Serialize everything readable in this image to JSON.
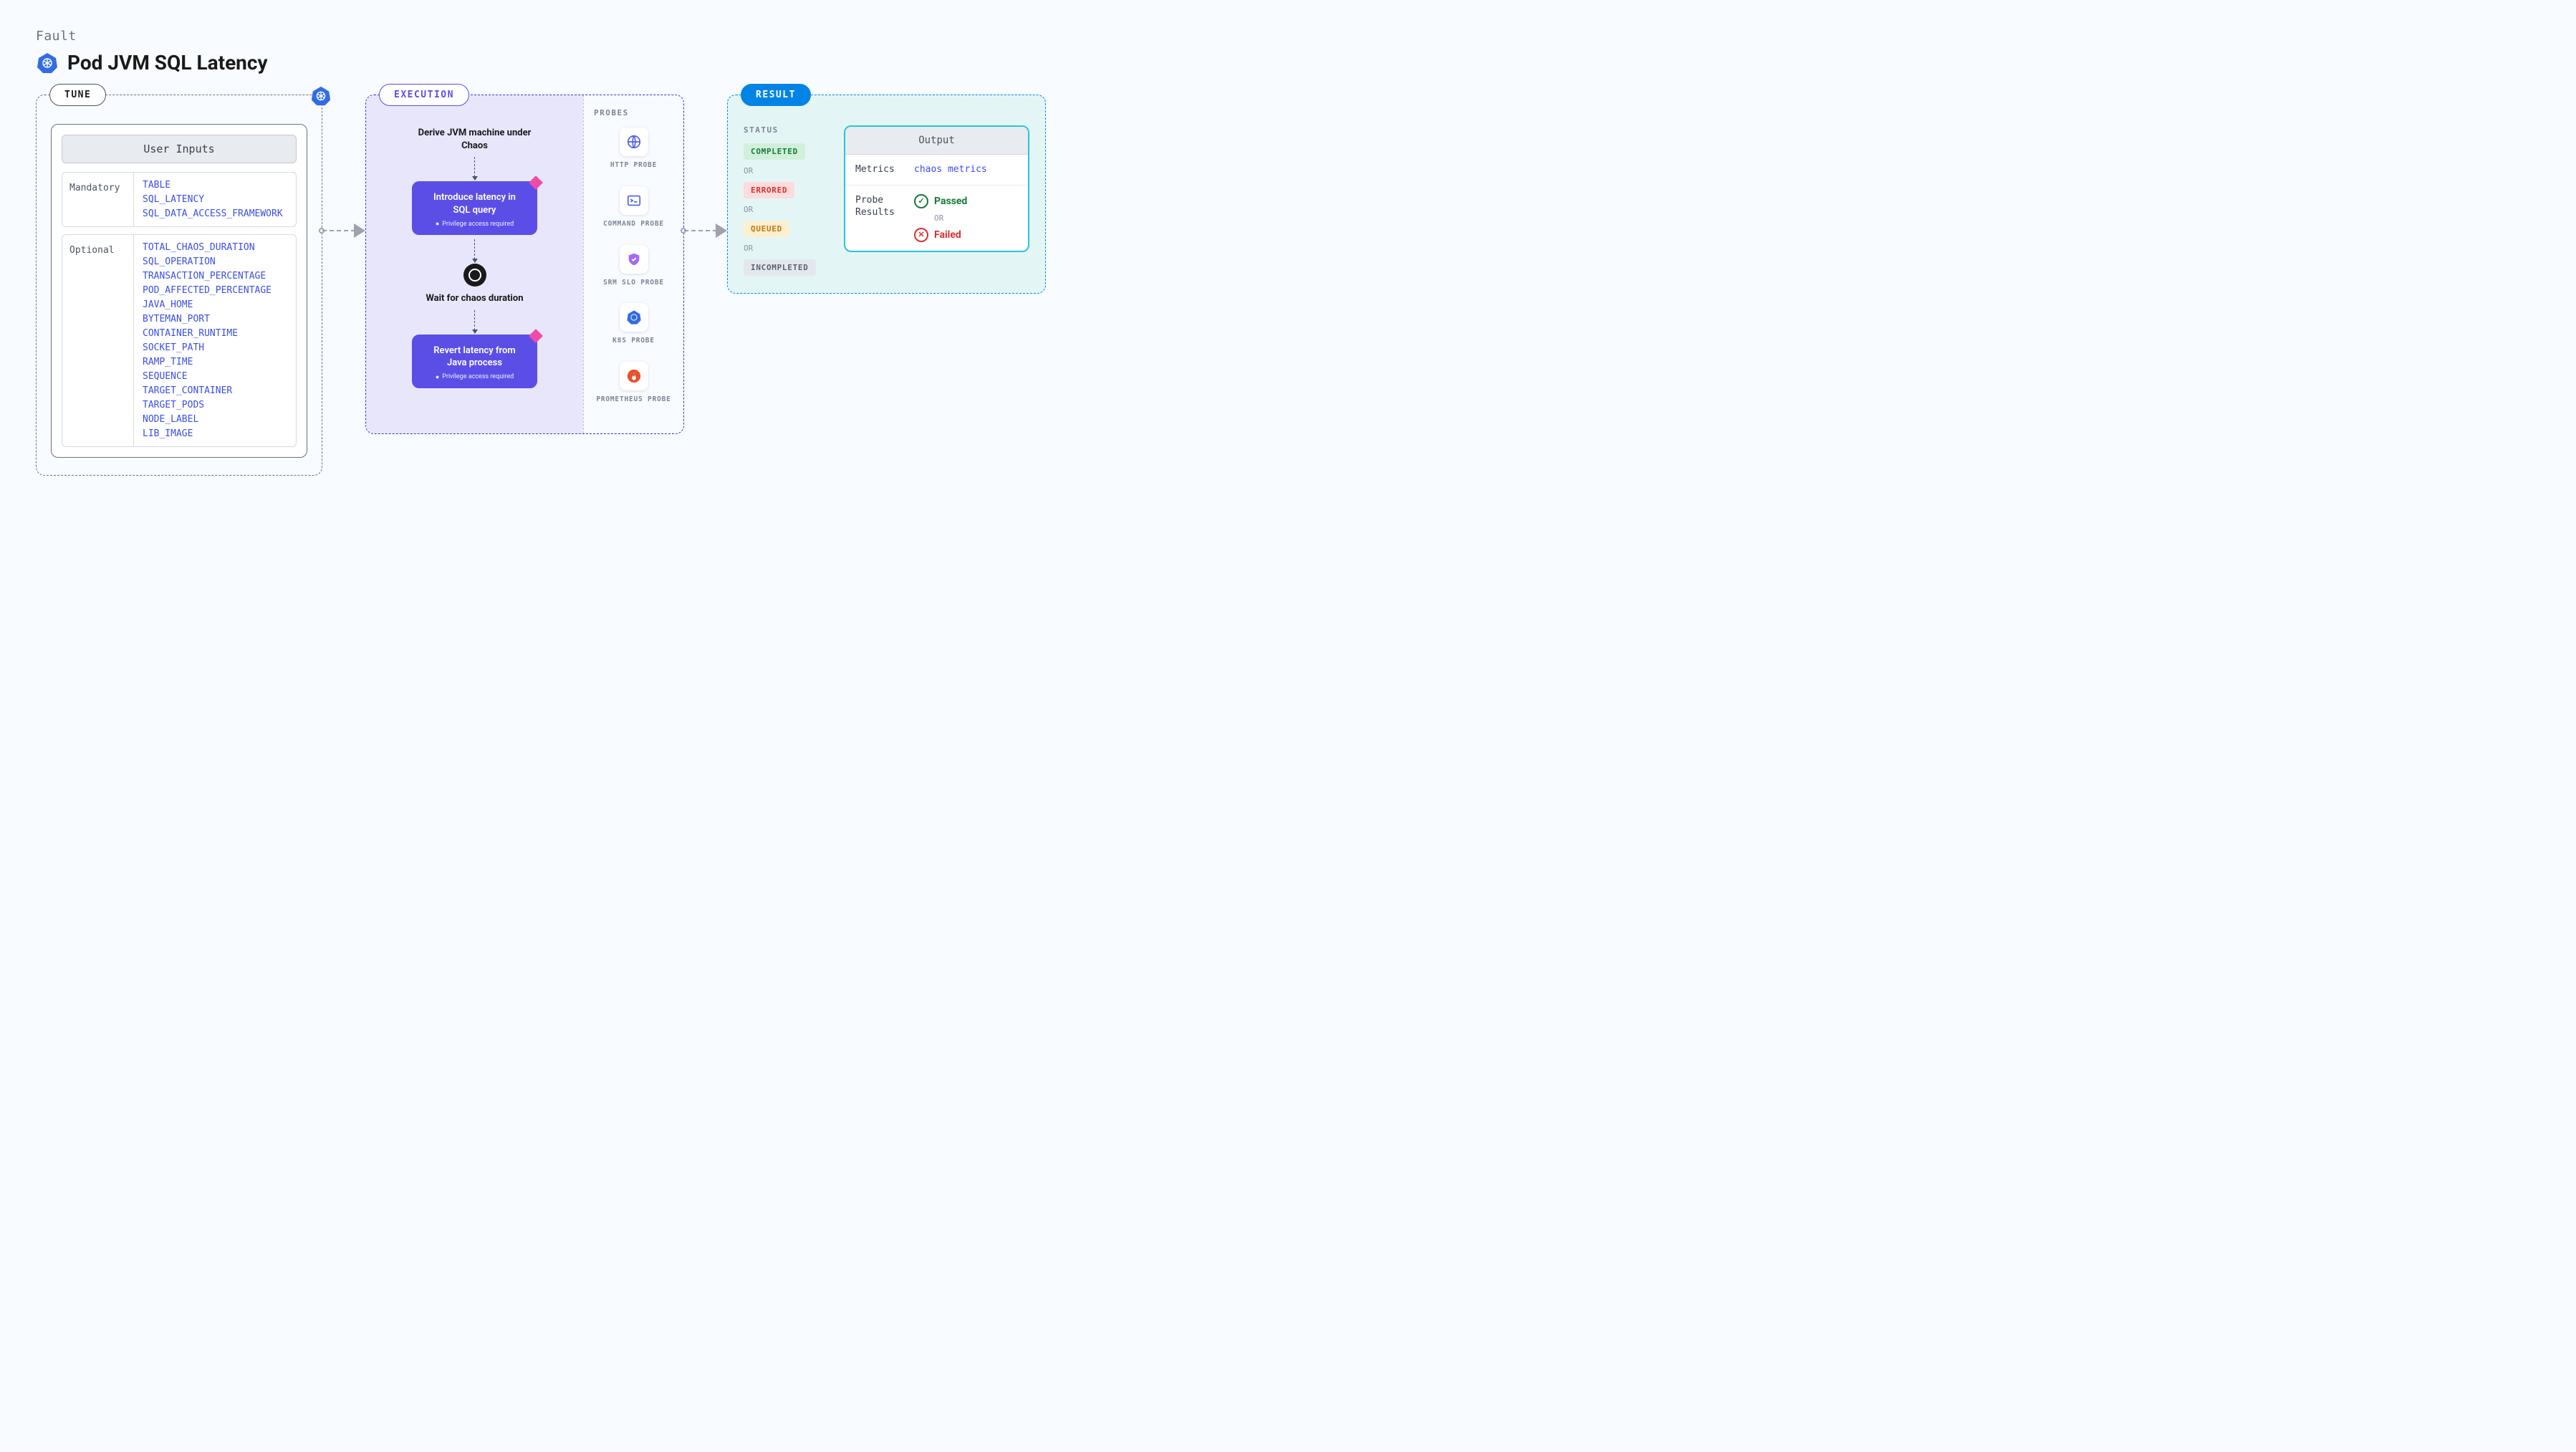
{
  "header": {
    "label": "Fault",
    "title": "Pod JVM SQL Latency"
  },
  "tune": {
    "label": "TUNE",
    "card_title": "User Inputs",
    "mandatory_label": "Mandatory",
    "mandatory_items": [
      "TABLE",
      "SQL_LATENCY",
      "SQL_DATA_ACCESS_FRAMEWORK"
    ],
    "optional_label": "Optional",
    "optional_items": [
      "TOTAL_CHAOS_DURATION",
      "SQL_OPERATION",
      "TRANSACTION_PERCENTAGE",
      "POD_AFFECTED_PERCENTAGE",
      "JAVA_HOME",
      "BYTEMAN_PORT",
      "CONTAINER_RUNTIME",
      "SOCKET_PATH",
      "RAMP_TIME",
      "SEQUENCE",
      "TARGET_CONTAINER",
      "TARGET_PODS",
      "NODE_LABEL",
      "LIB_IMAGE"
    ]
  },
  "execution": {
    "label": "EXECUTION",
    "step1": "Derive JVM machine under Chaos",
    "card1_title": "Introduce latency in SQL query",
    "card_note": "Privilege access required",
    "step2": "Wait for chaos duration",
    "card2_title": "Revert latency from Java process",
    "probes_label": "PROBES",
    "probes": [
      {
        "label": "HTTP PROBE",
        "icon": "globe"
      },
      {
        "label": "COMMAND PROBE",
        "icon": "terminal"
      },
      {
        "label": "SRM SLO PROBE",
        "icon": "shield"
      },
      {
        "label": "K8S PROBE",
        "icon": "k8s"
      },
      {
        "label": "PROMETHEUS PROBE",
        "icon": "flame"
      }
    ]
  },
  "result": {
    "label": "RESULT",
    "status_label": "STATUS",
    "statuses": [
      "COMPLETED",
      "ERRORED",
      "QUEUED",
      "INCOMPLETED"
    ],
    "or": "OR",
    "output_header": "Output",
    "metrics_key": "Metrics",
    "metrics_val": "chaos metrics",
    "probe_results_key": "Probe Results",
    "passed": "Passed",
    "failed": "Failed"
  }
}
